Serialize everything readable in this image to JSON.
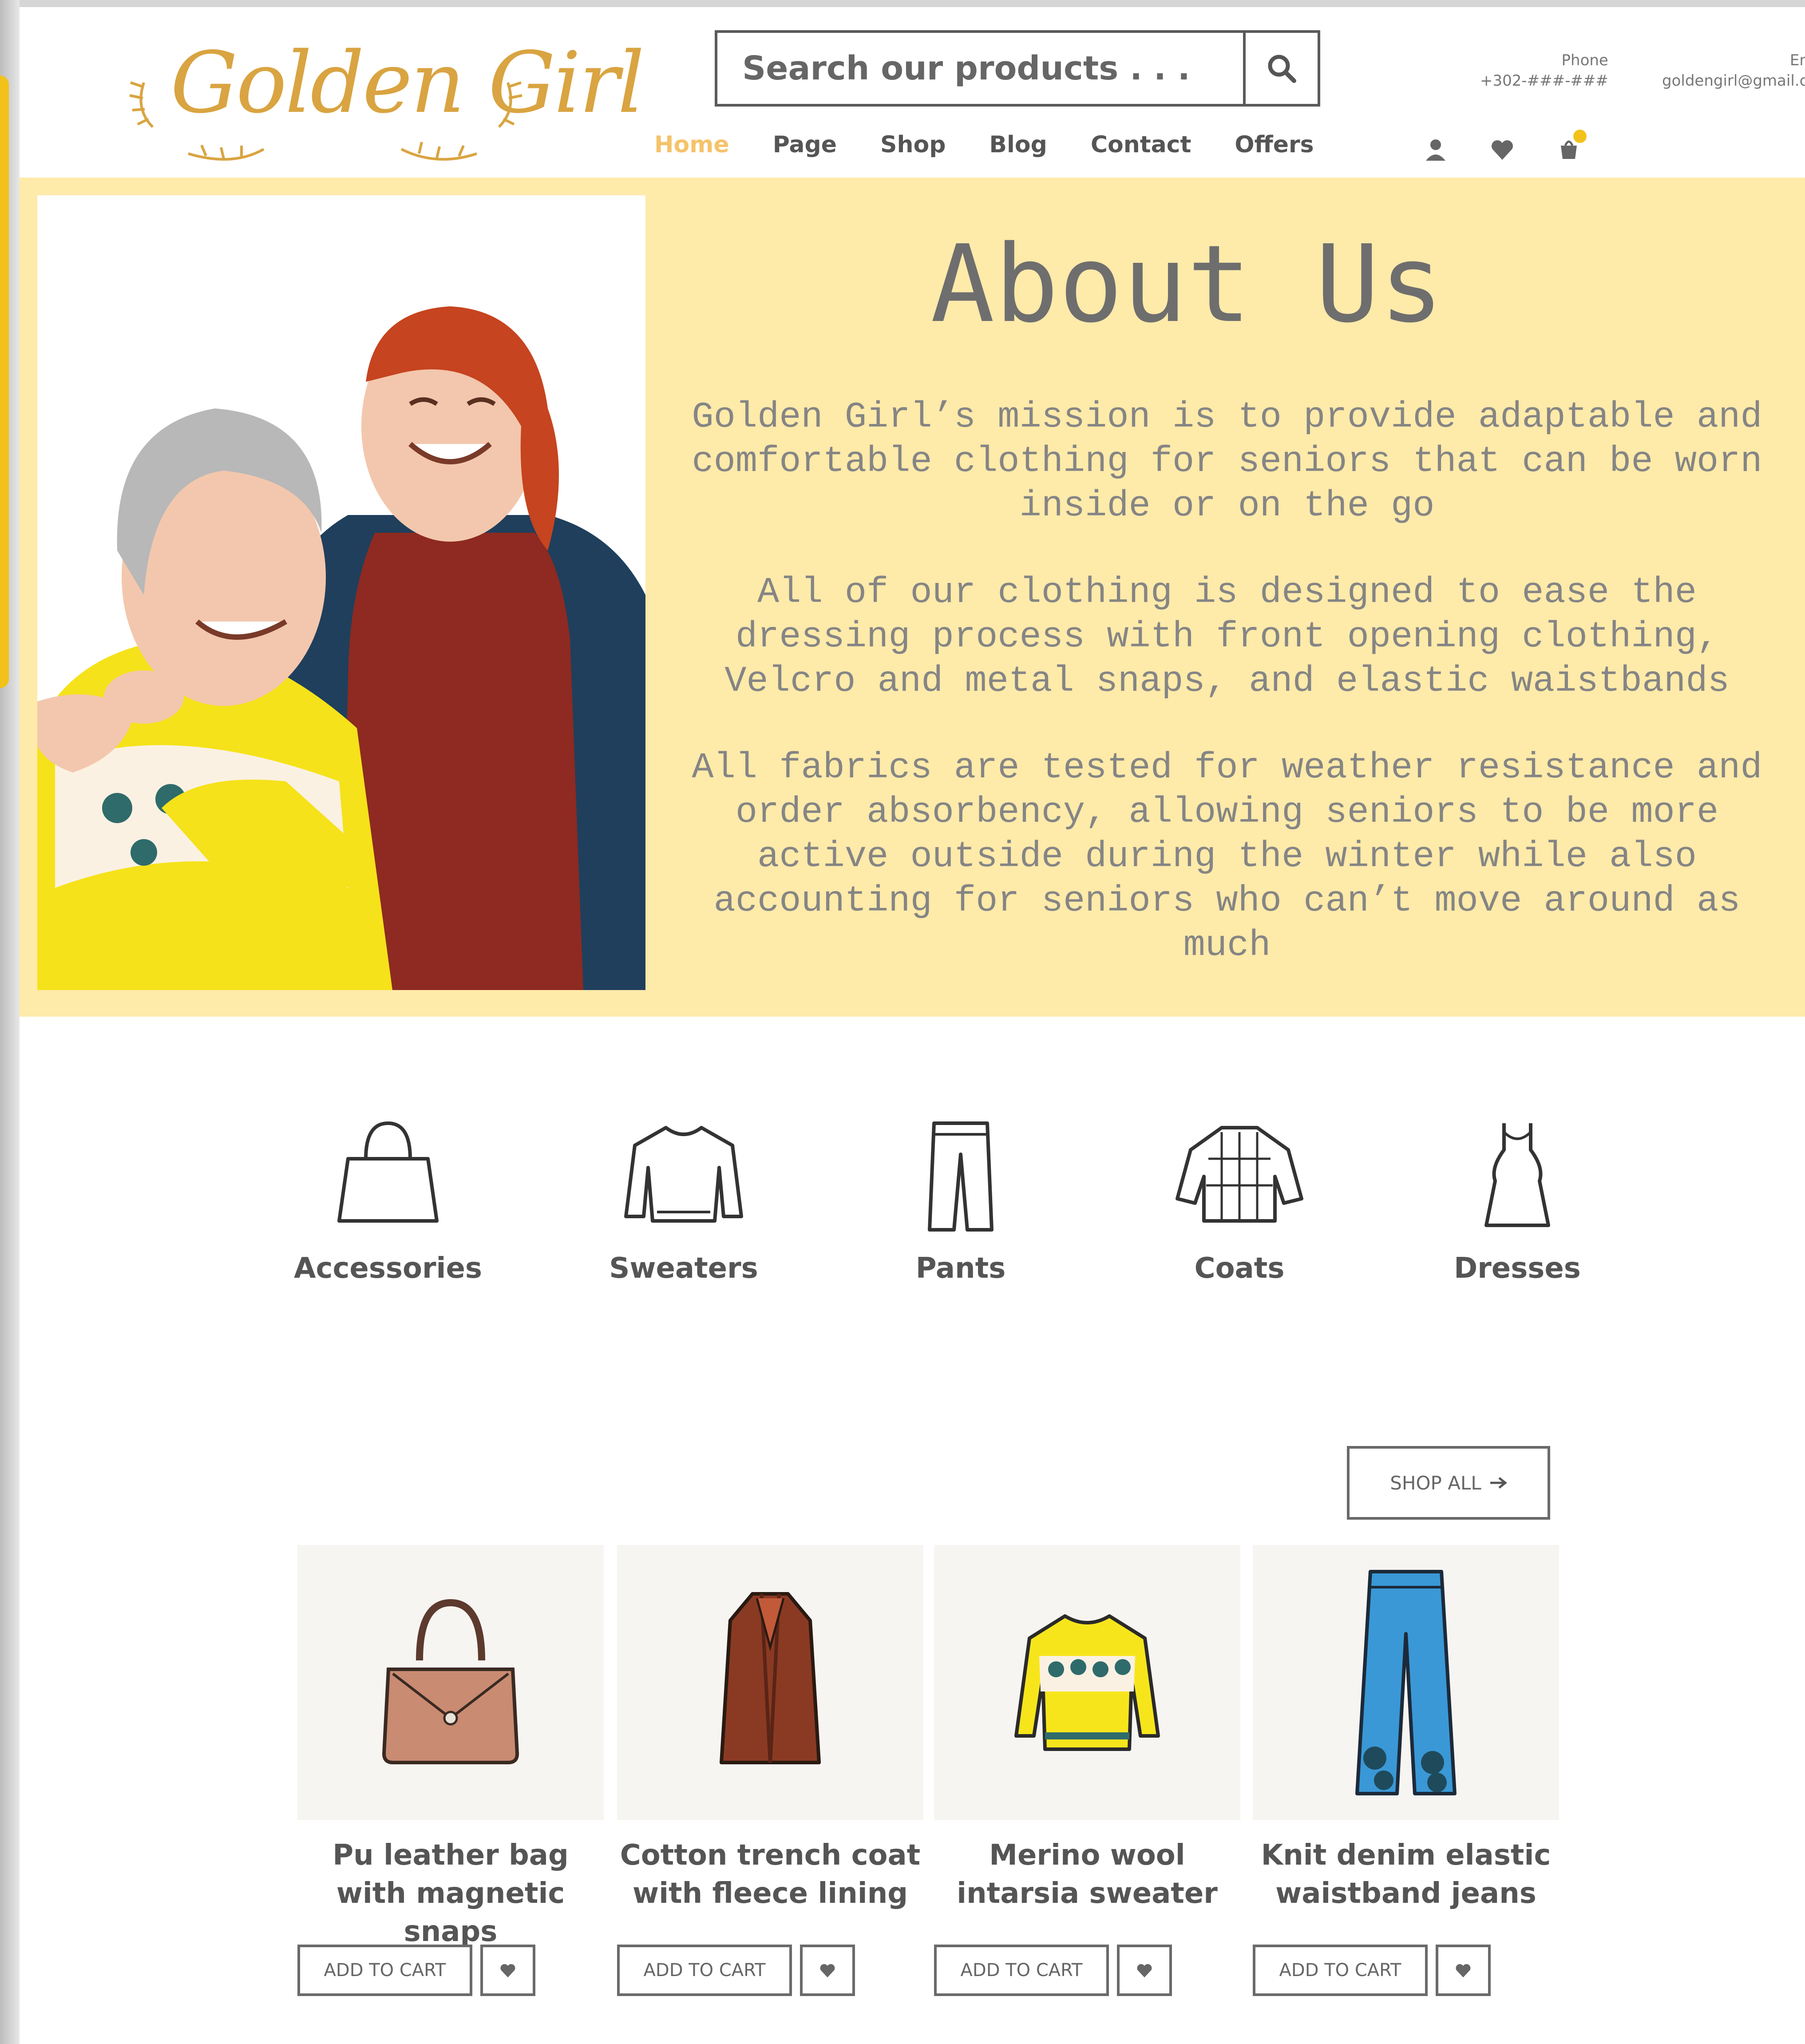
{
  "header": {
    "logo_text": "Golden Girl",
    "search": {
      "placeholder": "Search our products . . ."
    },
    "phone": {
      "label": "Phone",
      "value": "+302-###-###"
    },
    "email": {
      "label": "Email",
      "value": "goldengirl@gmail.com"
    },
    "nav": [
      {
        "label": "Home",
        "active": true
      },
      {
        "label": "Page",
        "active": false
      },
      {
        "label": "Shop",
        "active": false
      },
      {
        "label": "Blog",
        "active": false
      },
      {
        "label": "Contact",
        "active": false
      },
      {
        "label": "Offers",
        "active": false
      }
    ],
    "icons": [
      "user-icon",
      "heart-icon",
      "cart-icon"
    ]
  },
  "hero": {
    "title": "About Us",
    "paragraphs": [
      "Golden Girl’s mission is to provide adaptable and comfortable clothing for seniors that can be worn inside or on the go",
      "All of our clothing is designed to ease the dressing process with front opening clothing, Velcro and metal snaps, and elastic waistbands",
      "All fabrics are tested for weather resistance and order absorbency, allowing seniors to be more active outside during the winter while also accounting for seniors who can’t move around as much"
    ]
  },
  "categories": [
    {
      "label": "Accessories",
      "icon": "handbag-icon"
    },
    {
      "label": "Sweaters",
      "icon": "sweater-icon"
    },
    {
      "label": "Pants",
      "icon": "pants-icon"
    },
    {
      "label": "Coats",
      "icon": "coat-icon"
    },
    {
      "label": "Dresses",
      "icon": "dress-icon"
    }
  ],
  "shop_all": "SHOP ALL",
  "products": [
    {
      "name": "Pu leather bag with magnetic snaps",
      "add_to_cart": "ADD TO CART"
    },
    {
      "name": "Cotton trench coat with fleece lining",
      "add_to_cart": "ADD TO CART"
    },
    {
      "name": "Merino wool intarsia sweater",
      "add_to_cart": "ADD TO CART"
    },
    {
      "name": "Knit denim elastic waistband jeans",
      "add_to_cart": "ADD TO CART"
    }
  ],
  "colors": {
    "hero_background": "#feeaa9",
    "logo_gold": "#d9a441",
    "active_nav": "#f5c36a",
    "accent_yellow": "#f2c21b"
  }
}
